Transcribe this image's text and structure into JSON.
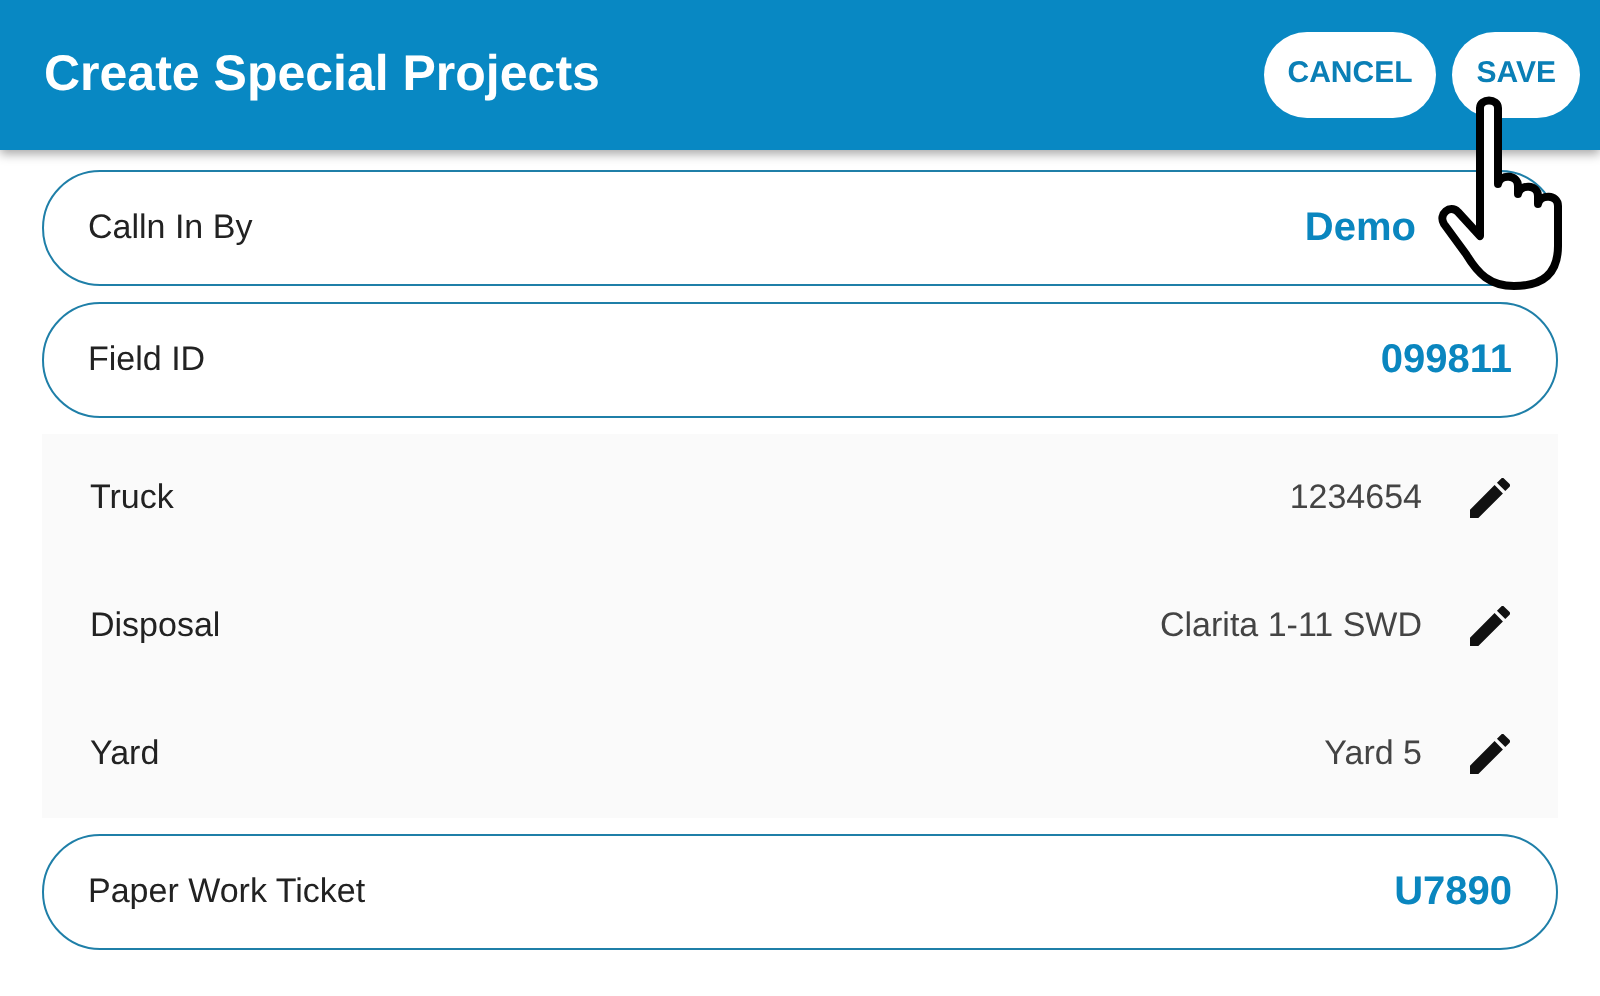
{
  "header": {
    "title": "Create Special Projects",
    "buttons": [
      {
        "label": "CANCEL"
      },
      {
        "label": "SAVE"
      }
    ]
  },
  "fields": [
    {
      "kind": "pill",
      "label": "Calln In By",
      "value": "Demo"
    },
    {
      "kind": "pill",
      "label": "Field ID",
      "value": "099811"
    },
    {
      "kind": "editable",
      "label": "Truck",
      "value": "1234654"
    },
    {
      "kind": "editable",
      "label": "Disposal",
      "value": "Clarita 1-11 SWD"
    },
    {
      "kind": "editable",
      "label": "Yard",
      "value": "Yard 5"
    },
    {
      "kind": "pill",
      "label": "Paper Work Ticket",
      "value": "U7890"
    }
  ]
}
